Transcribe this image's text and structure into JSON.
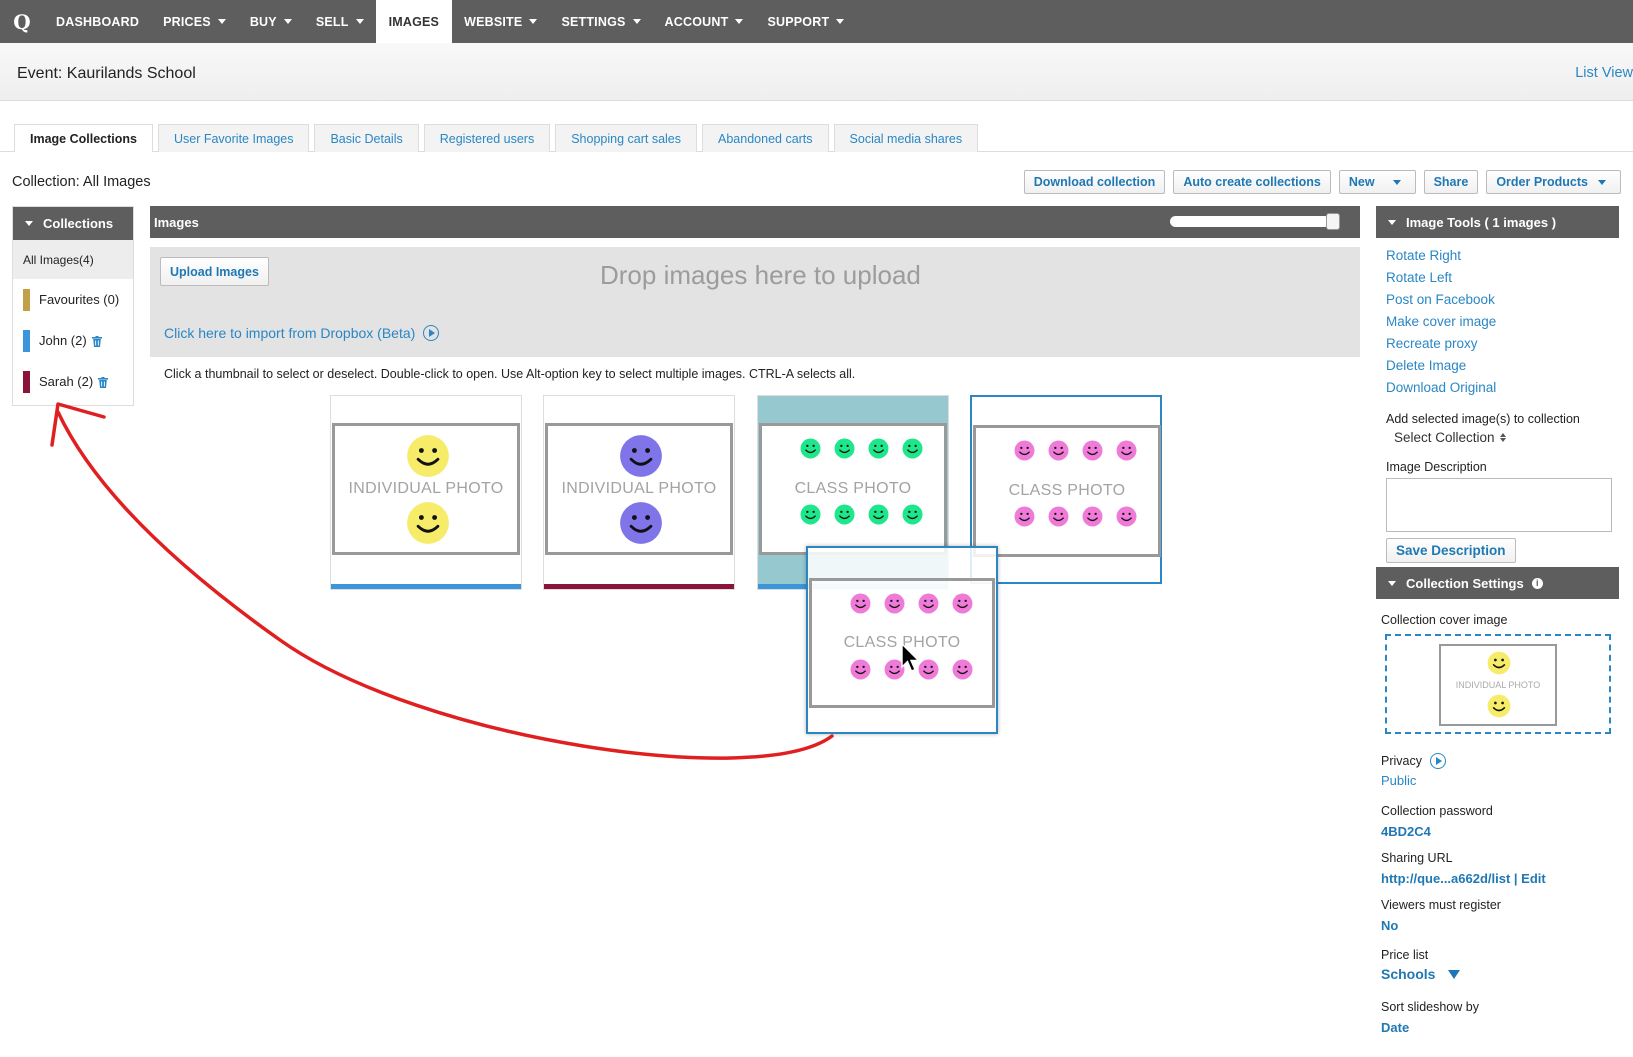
{
  "nav": {
    "logo": "Q",
    "items": [
      {
        "label": "DASHBOARD",
        "caret": false,
        "active": false
      },
      {
        "label": "PRICES",
        "caret": true,
        "active": false
      },
      {
        "label": "BUY",
        "caret": true,
        "active": false
      },
      {
        "label": "SELL",
        "caret": true,
        "active": false
      },
      {
        "label": "IMAGES",
        "caret": false,
        "active": true
      },
      {
        "label": "WEBSITE",
        "caret": true,
        "active": false
      },
      {
        "label": "SETTINGS",
        "caret": true,
        "active": false
      },
      {
        "label": "ACCOUNT",
        "caret": true,
        "active": false
      },
      {
        "label": "SUPPORT",
        "caret": true,
        "active": false
      }
    ]
  },
  "event": {
    "title": "Event: Kaurilands School",
    "list_view": "List View"
  },
  "tabs": [
    {
      "label": "Image Collections",
      "active": true
    },
    {
      "label": "User Favorite Images",
      "active": false
    },
    {
      "label": "Basic Details",
      "active": false
    },
    {
      "label": "Registered users",
      "active": false
    },
    {
      "label": "Shopping cart sales",
      "active": false
    },
    {
      "label": "Abandoned carts",
      "active": false
    },
    {
      "label": "Social media shares",
      "active": false
    }
  ],
  "collection_title": "Collection: All Images",
  "actions": {
    "download": "Download collection",
    "auto_create": "Auto create collections",
    "new": "New",
    "share": "Share",
    "order": "Order Products"
  },
  "collections": {
    "header": "Collections",
    "all": "All Images(4)",
    "items": [
      {
        "label": "Favourites (0)",
        "color": "#c2a04a",
        "deletable": false
      },
      {
        "label": "John (2)",
        "color": "#3c95d8",
        "deletable": true
      },
      {
        "label": "Sarah (2)",
        "color": "#8a1538",
        "deletable": true
      }
    ]
  },
  "images": {
    "header": "Images",
    "upload_button": "Upload Images",
    "drop_text": "Drop images here to upload",
    "dropbox_link": "Click here to import from Dropbox (Beta)",
    "hint": "Click a thumbnail to select or deselect. Double-click to open. Use Alt-option key to select multiple images. CTRL-A selects all.",
    "thumbnails": [
      {
        "label": "INDIVIDUAL PHOTO",
        "smiley_color": "#f7ec6a",
        "bar_color": "#3c95d8"
      },
      {
        "label": "INDIVIDUAL PHOTO",
        "smiley_color": "#7f74e8",
        "bar_color": "#8a1538"
      },
      {
        "label": "CLASS PHOTO",
        "smiley_color": "#1ee68a",
        "bar_color": "#3c95d8"
      },
      {
        "label": "CLASS PHOTO",
        "smiley_color": "#ef7ad8",
        "bar_color": ""
      }
    ],
    "ghost": {
      "label": "CLASS PHOTO",
      "smiley_color": "#ef7ad8"
    }
  },
  "tools": {
    "header": "Image Tools ( 1 images )",
    "links": [
      "Rotate Right",
      "Rotate Left",
      "Post on Facebook",
      "Make cover image",
      "Recreate proxy",
      "Delete Image",
      "Download Original"
    ],
    "add_to_collection_label": "Add selected image(s) to collection",
    "select_collection": "Select Collection",
    "description_label": "Image Description",
    "save_description": "Save Description"
  },
  "settings": {
    "header": "Collection Settings",
    "cover_label": "Collection cover image",
    "cover_photo_label": "INDIVIDUAL PHOTO",
    "privacy_label": "Privacy",
    "privacy_value": "Public",
    "password_label": "Collection password",
    "password_value": "4BD2C4",
    "sharing_label": "Sharing URL",
    "sharing_value": "http://que...a662d/list",
    "sharing_edit": "Edit",
    "register_label": "Viewers must register",
    "register_value": "No",
    "price_label": "Price list",
    "price_value": "Schools",
    "sort_label": "Sort slideshow by",
    "sort_value": "Date"
  },
  "colors": {
    "accent": "#2a87c4",
    "navbar": "#5e5e5e",
    "drag_arrow": "#e02020"
  }
}
